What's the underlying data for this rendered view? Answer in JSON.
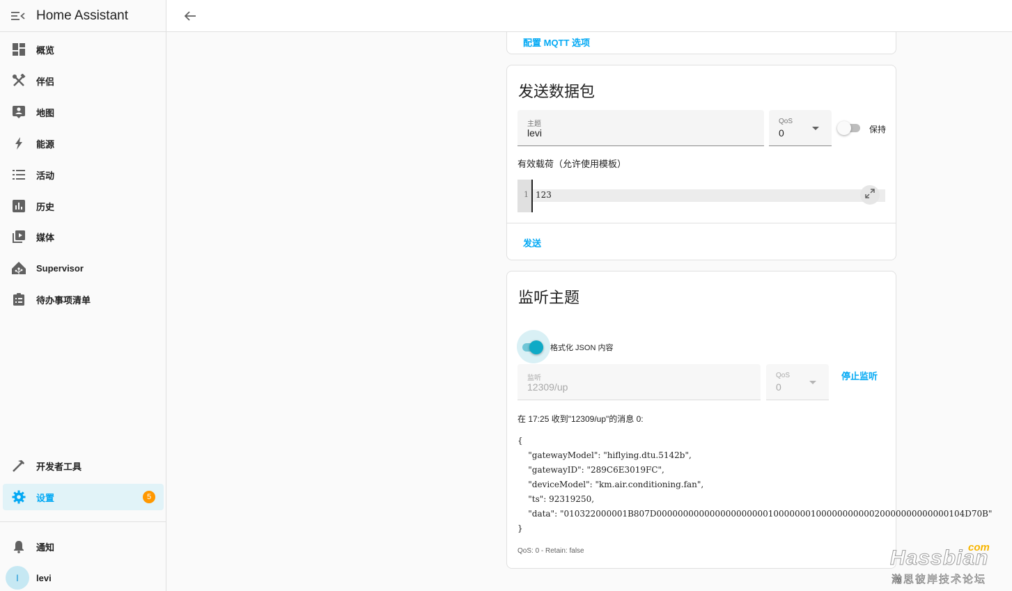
{
  "app": {
    "title": "Home Assistant"
  },
  "sidebar": {
    "items": [
      {
        "label": "概览",
        "icon": "dashboard-icon"
      },
      {
        "label": "伴侣",
        "icon": "tools-icon"
      },
      {
        "label": "地图",
        "icon": "map-account-icon"
      },
      {
        "label": "能源",
        "icon": "lightning-bolt-icon"
      },
      {
        "label": "活动",
        "icon": "format-list-icon"
      },
      {
        "label": "历史",
        "icon": "chart-box-icon"
      },
      {
        "label": "媒体",
        "icon": "play-box-multiple-icon"
      },
      {
        "label": "Supervisor",
        "icon": "home-assistant-icon"
      },
      {
        "label": "待办事项清单",
        "icon": "clipboard-list-icon"
      }
    ],
    "developer_tools": "开发者工具",
    "settings": {
      "label": "设置",
      "badge": "5"
    },
    "notifications": "通知",
    "user": {
      "name": "levi",
      "initial": "l"
    }
  },
  "config_card": {
    "link": "配置 MQTT 选项"
  },
  "publish": {
    "title": "发送数据包",
    "topic_label": "主题",
    "topic_value": "levi",
    "qos_label": "QoS",
    "qos_value": "0",
    "retain_label": "保持",
    "retain_on": false,
    "payload_label": "有效载荷（允许使用模板）",
    "line_number": "1",
    "payload": "123",
    "send_button": "发送"
  },
  "listen": {
    "title": "监听主题",
    "format_json_label": "格式化 JSON 内容",
    "format_json_on": true,
    "topic_label": "监听",
    "topic_value": "12309/up",
    "qos_label": "QoS",
    "qos_value": "0",
    "stop_button": "停止监听",
    "message_header": "在 17:25 收到\"12309/up\"的消息 0:",
    "message_body": "{\n    \"gatewayModel\": \"hiflying.dtu.5142b\",\n    \"gatewayID\": \"289C6E3019FC\",\n    \"deviceModel\": \"km.air.conditioning.fan\",\n    \"ts\": 92319250,\n    \"data\": \"010322000001B807D0000000000000000000001000000010000000000020000000000000104D70B\"\n}",
    "message_footer": "QoS: 0 - Retain: false"
  },
  "watermark": {
    "brand": "Hassbian",
    "com": "com",
    "subtitle": "瀚思彼岸技术论坛"
  },
  "colors": {
    "accent": "#03a9f4",
    "switch_on": "#0faac6",
    "badge": "#ff9800"
  }
}
